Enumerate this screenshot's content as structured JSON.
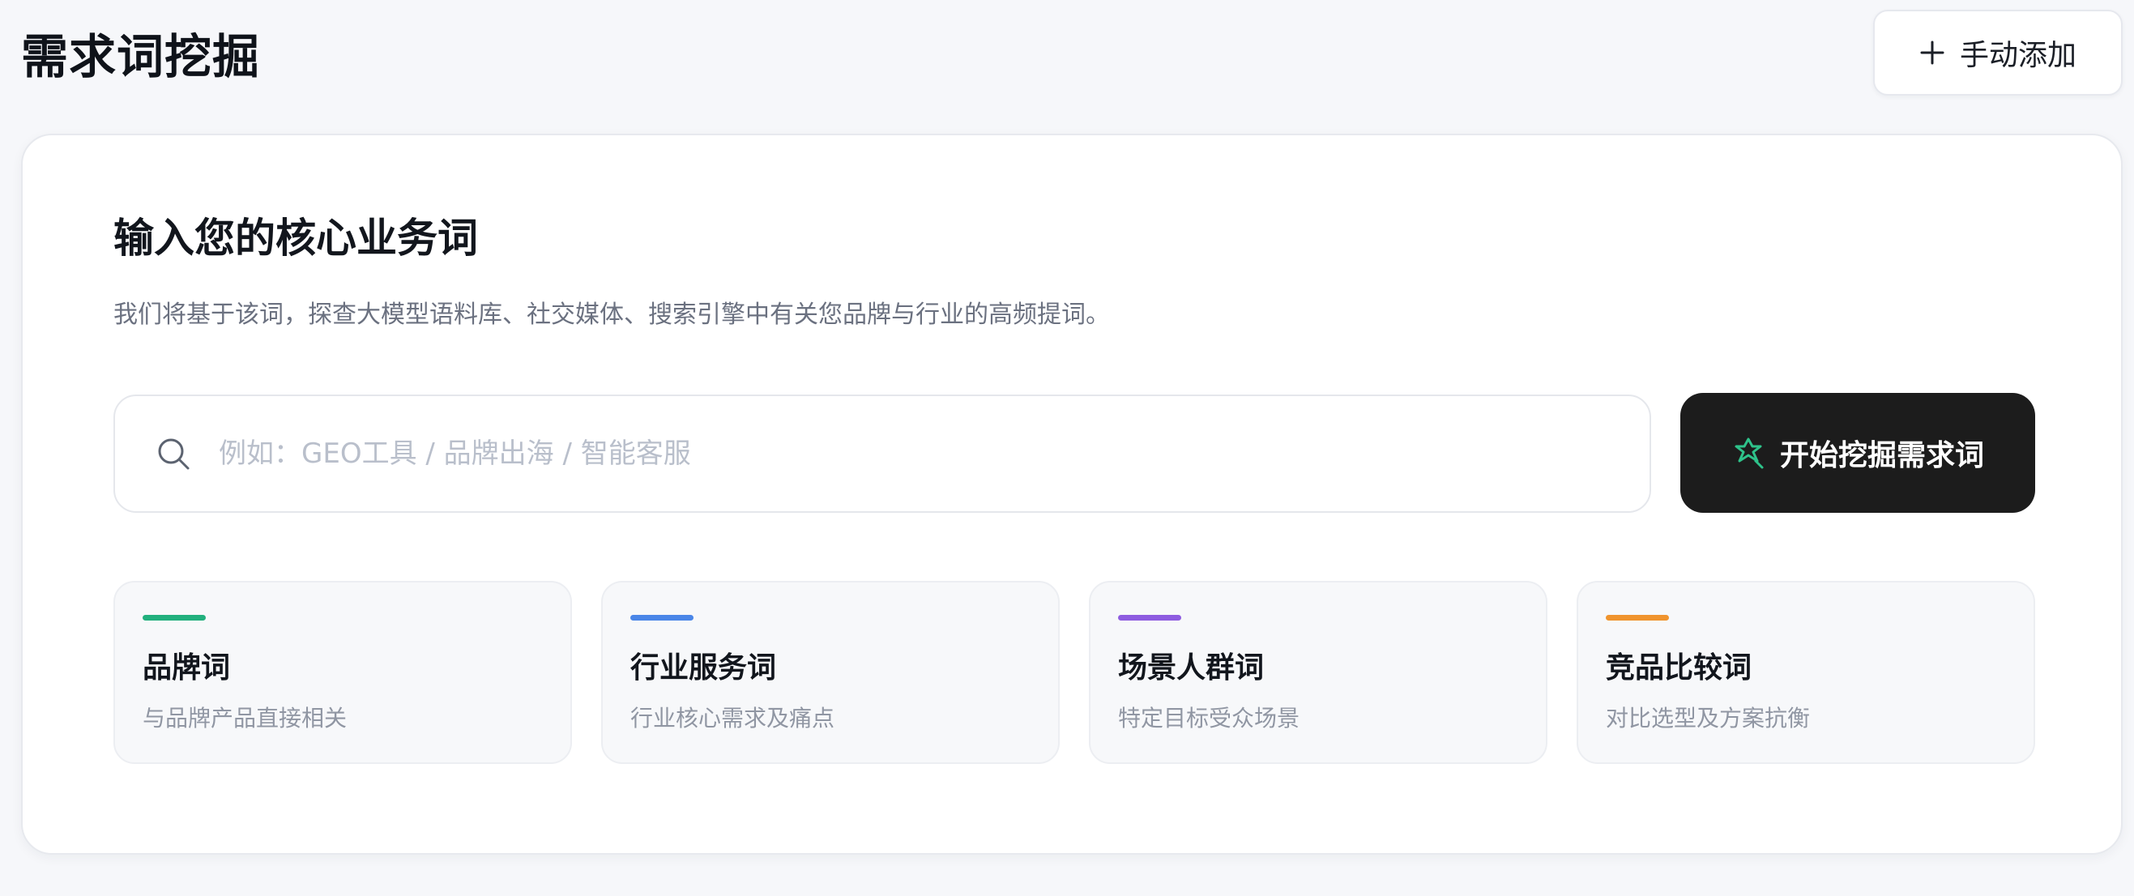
{
  "header": {
    "title": "需求词挖掘",
    "add_button_label": "手动添加"
  },
  "main": {
    "section_title": "输入您的核心业务词",
    "section_description": "我们将基于该词，探查大模型语料库、社交媒体、搜索引擎中有关您品牌与行业的高频提词。",
    "search": {
      "value": "",
      "placeholder": "例如：GEO工具 / 品牌出海 / 智能客服"
    },
    "start_button_label": "开始挖掘需求词",
    "categories": [
      {
        "title": "品牌词",
        "description": "与品牌产品直接相关",
        "accent_color": "#22b07d"
      },
      {
        "title": "行业服务词",
        "description": "行业核心需求及痛点",
        "accent_color": "#4a86e8"
      },
      {
        "title": "场景人群词",
        "description": "特定目标受众场景",
        "accent_color": "#8e5ce0"
      },
      {
        "title": "竞品比较词",
        "description": "对比选型及方案抗衡",
        "accent_color": "#f0942e"
      }
    ]
  },
  "icons": {
    "add": "plus-icon",
    "search": "search-icon",
    "start": "sparkle-icon"
  },
  "colors": {
    "primary_button": "#1c1c1c",
    "start_icon": "#2ec28a"
  }
}
